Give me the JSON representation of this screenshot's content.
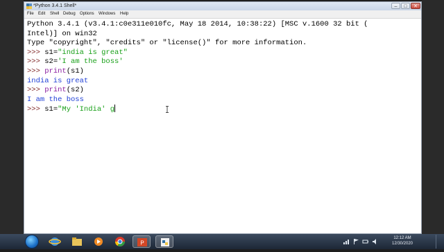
{
  "window": {
    "title": "*Python 3.4.1 Shell*",
    "min_label": "–",
    "max_label": "□",
    "close_label": "✕"
  },
  "menu": [
    "File",
    "Edit",
    "Shell",
    "Debug",
    "Options",
    "Windows",
    "Help"
  ],
  "shell": {
    "banner1": "Python 3.4.1 (v3.4.1:c0e311e010fc, May 18 2014, 10:38:22) [MSC v.1600 32 bit (",
    "banner2": "Intel)] on win32",
    "banner3": "Type \"copyright\", \"credits\" or \"license()\" for more information.",
    "prompt": ">>> ",
    "l1_a": "s1=",
    "l1_b": "\"india is great\"",
    "l2_a": "s2=",
    "l2_b": "'I am the boss'",
    "l3_kw": "print",
    "l3_arg": "(s1)",
    "out1": "india is great",
    "l4_kw": "print",
    "l4_arg": "(s2)",
    "out2": "I am the boss",
    "l5_a": "s1=",
    "l5_b": "\"My 'India' g"
  },
  "taskbar": {
    "time": "12:12 AM",
    "date": "12/30/2020",
    "icons": [
      "start",
      "internet-explorer",
      "file-explorer",
      "media-player",
      "chrome",
      "powerpoint",
      "python-idle"
    ]
  },
  "colors": {
    "prompt": "#7a1f1f",
    "string": "#19a019",
    "keyword": "#8a1fa0",
    "output": "#1f3fd6"
  }
}
